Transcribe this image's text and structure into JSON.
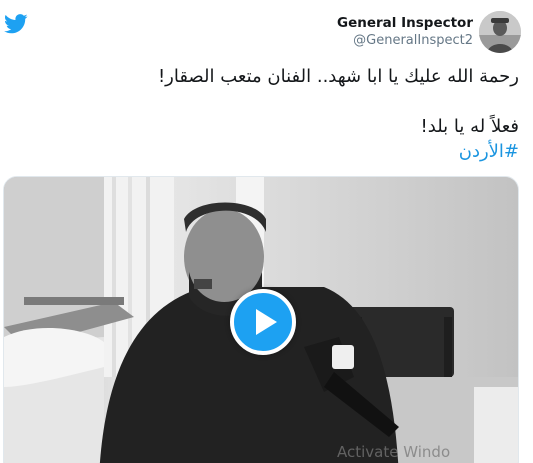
{
  "author": {
    "display_name": "General Inspector",
    "handle": "@GeneralInspect2"
  },
  "tweet": {
    "line1": "رحمة الله عليك يا ابا شهد.. الفنان متعب الصقار!",
    "line2": "فعلاً له يا بلد!",
    "hashtag": "#الأردن"
  },
  "media": {
    "type": "video",
    "watermark": "Activate Windo"
  },
  "icons": {
    "brand": "twitter-bird-icon",
    "play": "play-icon"
  },
  "colors": {
    "brand_blue": "#1da1f2",
    "hashtag_blue": "#1b95e0",
    "text": "#14171a",
    "secondary_text": "#657786"
  }
}
